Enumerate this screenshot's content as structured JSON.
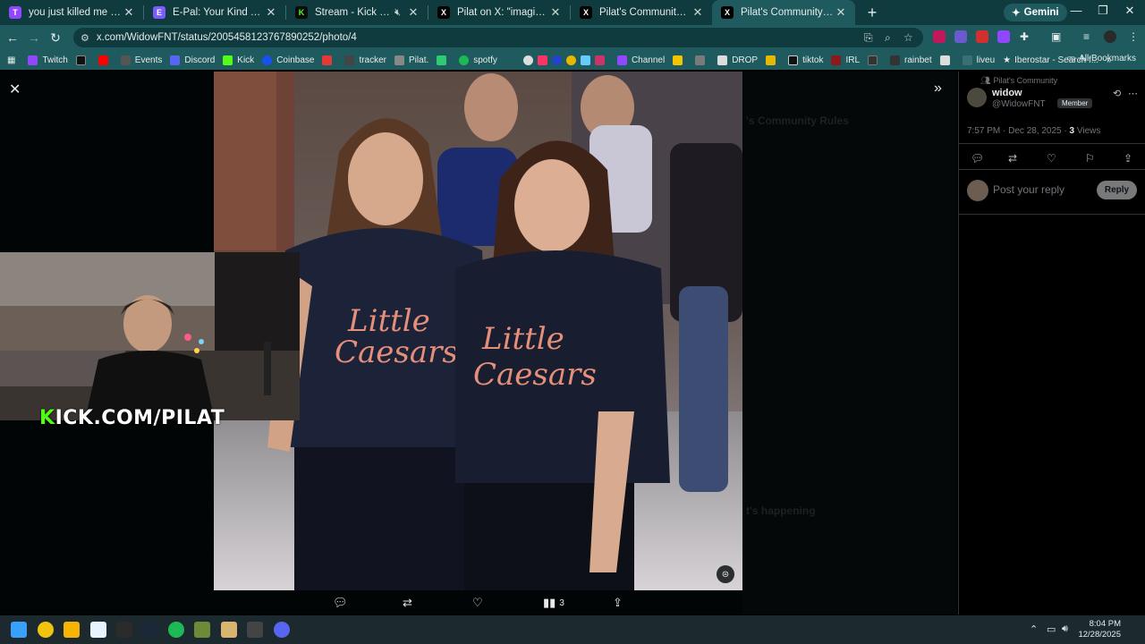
{
  "browser": {
    "tabs": [
      {
        "title": "you just killed me you - Twitch",
        "icon": "twitch-icon",
        "color": "#9146ff"
      },
      {
        "title": "E-Pal: Your Kind Teammates",
        "icon": "epal-icon",
        "color": "#7b5cff"
      },
      {
        "title": "Stream - Kick Dashboard",
        "icon": "kick-icon",
        "color": "#53fc18"
      },
      {
        "title": "Pilat on X: \"imagine having a b",
        "icon": "x-icon",
        "color": "#000000"
      },
      {
        "title": "Pilat's Community Community",
        "icon": "x-icon",
        "color": "#000000"
      },
      {
        "title": "Pilat's Community Community",
        "icon": "x-icon",
        "color": "#000000",
        "active": true
      }
    ],
    "gemini_label": "Gemini",
    "url": "x.com/WidowFNT/status/2005458123767890252/photo/4",
    "bookmarks": [
      {
        "label": "Twitch",
        "color": "#9146ff"
      },
      {
        "label": "",
        "color": "#111111"
      },
      {
        "label": "",
        "color": "#ff0000"
      },
      {
        "label": "Events",
        "color": "#555555"
      },
      {
        "label": "Discord",
        "color": "#5865f2"
      },
      {
        "label": "Kick",
        "color": "#53fc18"
      },
      {
        "label": "Coinbase",
        "color": "#1652f0"
      },
      {
        "label": "",
        "color": "#e53935"
      },
      {
        "label": "tracker",
        "color": "#444444"
      },
      {
        "label": "Pilat.",
        "color": "#888888"
      },
      {
        "label": "",
        "color": "#2ecc71"
      },
      {
        "label": "spotfy",
        "color": "#1db954"
      }
    ],
    "bookmarks_right": [
      "Channel",
      "DROP",
      "tiktok",
      "IRL",
      "rainbet",
      "liveu",
      "Iberostar - Search f..."
    ],
    "all_bookmarks": "All Bookmarks"
  },
  "media_viewer": {
    "action_counts": {
      "views": "3"
    }
  },
  "overlay": {
    "kick_prefix": "K",
    "kick_rest": "ICK.COM/PILAT"
  },
  "post": {
    "community": "Pilat's Community",
    "name": "widow",
    "handle": "@WidowFNT",
    "badge": "Member",
    "time": "7:57 PM · Dec 28, 2025 · ",
    "views": "3",
    "views_label": " Views",
    "reply_placeholder": "Post your reply",
    "reply_button": "Reply"
  },
  "background_panel": {
    "headings": [
      "'s Community Rules",
      "t's happening"
    ]
  },
  "taskbar": {
    "time": "8:04 PM",
    "date": "12/28/2025"
  }
}
